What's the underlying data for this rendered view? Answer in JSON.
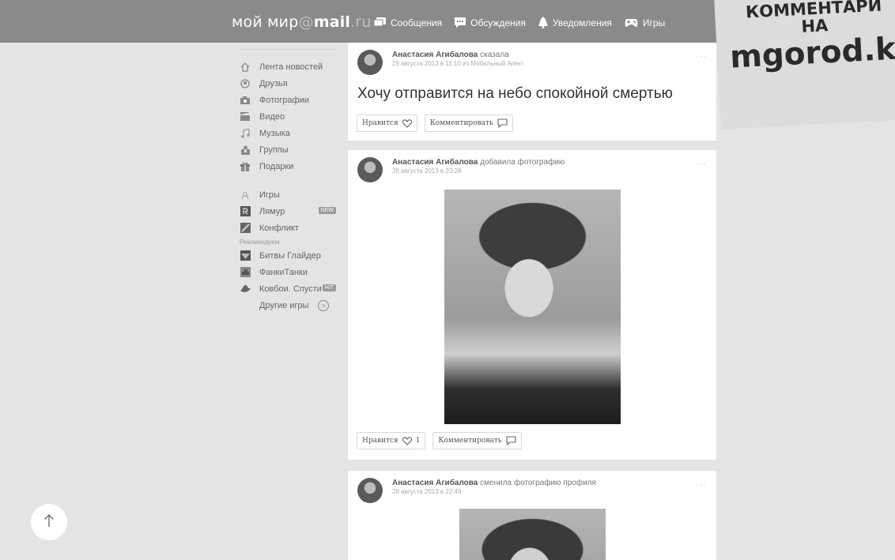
{
  "header": {
    "brand_moi": "мой мир",
    "brand_at": "@",
    "brand_mail": "mail",
    "brand_ru": ".ru",
    "nav": [
      {
        "label": "Сообщения",
        "icon": "messages-icon"
      },
      {
        "label": "Обсуждения",
        "icon": "discussions-icon"
      },
      {
        "label": "Уведомления",
        "icon": "bell-icon"
      },
      {
        "label": "Игры",
        "icon": "gamepad-icon"
      }
    ]
  },
  "banner": {
    "line1": "КОММЕНТАРИ",
    "line2": "НА",
    "line3": "mgorod.k"
  },
  "sidebar": {
    "items": [
      {
        "label": "Лента новостей",
        "icon": "news-icon"
      },
      {
        "label": "Друзья",
        "icon": "friends-icon"
      },
      {
        "label": "Фотографии",
        "icon": "photo-icon"
      },
      {
        "label": "Видео",
        "icon": "video-icon"
      },
      {
        "label": "Музыка",
        "icon": "music-icon"
      },
      {
        "label": "Группы",
        "icon": "groups-icon"
      },
      {
        "label": "Подарки",
        "icon": "gift-icon"
      }
    ],
    "games": [
      {
        "label": "Игры",
        "icon": "games-icon"
      },
      {
        "label": "Лямур",
        "icon": "lyamur-icon",
        "badge": "NEW"
      },
      {
        "label": "Конфликт",
        "icon": "conflict-icon"
      }
    ],
    "recommended_label": "Рекомендуем",
    "recommended": [
      {
        "label": "Битвы Глайдер",
        "icon": "glider-icon"
      },
      {
        "label": "ФанкиТанки",
        "icon": "tanks-icon"
      },
      {
        "label": "Ковбои. Спусти",
        "icon": "cowboy-icon",
        "badge": "HIT"
      }
    ],
    "more_games": "Другие игры"
  },
  "posts": [
    {
      "author": "Анастасия Агибалова",
      "action": " сказала",
      "time": "29 августа 2013 в 11:10 из Мобильный Агент",
      "text": "Хочу отправится на небо спокойной смертью",
      "like_label": "Нравится",
      "like_count": "",
      "comment_label": "Комментировать"
    },
    {
      "author": "Анастасия Агибалова",
      "action": " добавила фотографию",
      "time": "28 августа 2013 в 23:28",
      "like_label": "Нравится",
      "like_count": "1",
      "comment_label": "Комментировать"
    },
    {
      "author": "Анастасия Агибалова",
      "action": " сменила фотографию профиля",
      "time": "28 августа 2013 в 22:49"
    }
  ],
  "more_dots": "···",
  "scroll_top_icon": "arrow-up-icon"
}
